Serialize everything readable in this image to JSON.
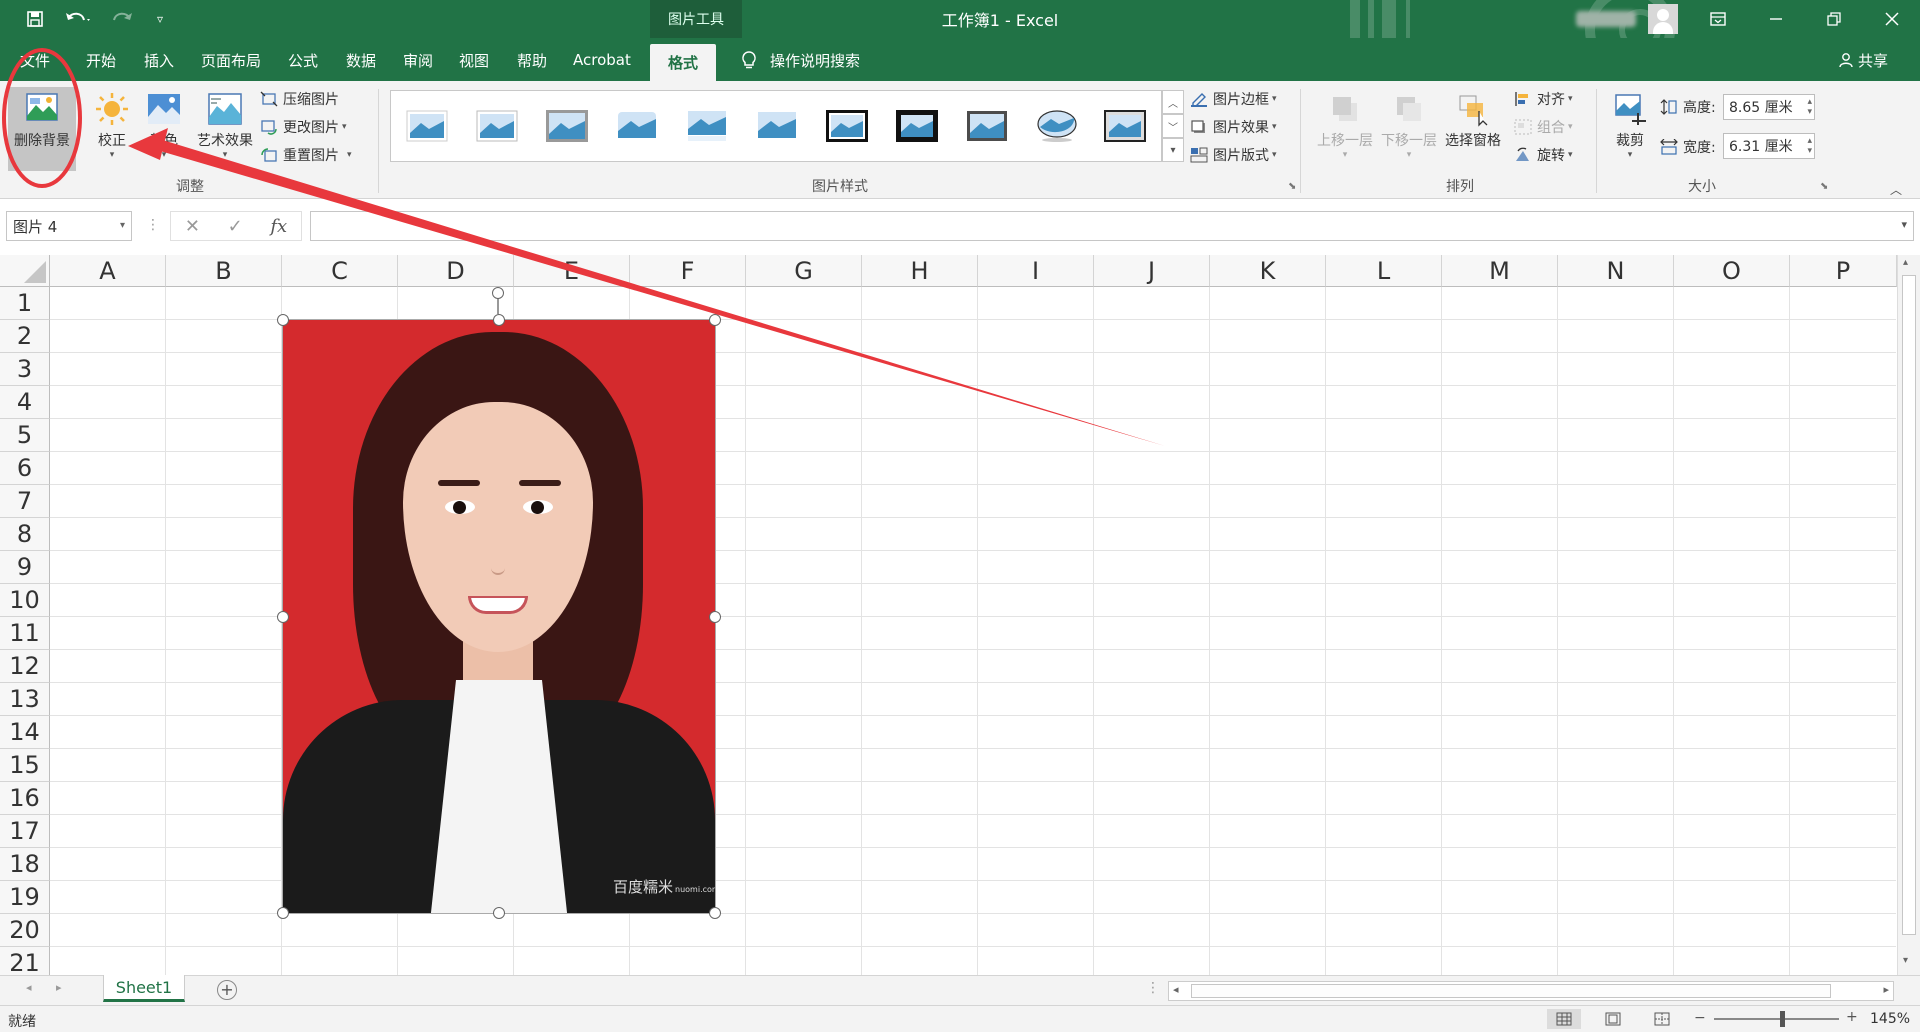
{
  "titlebar": {
    "context_tool": "图片工具",
    "document": "工作簿1 - Excel",
    "window_controls": [
      "ribbon-display-icon",
      "minimize-icon",
      "restore-icon",
      "close-icon"
    ]
  },
  "quick_access": {
    "icons": [
      "save-icon",
      "undo-icon",
      "redo-icon",
      "customize-icon"
    ]
  },
  "tabs": [
    {
      "label": "文件"
    },
    {
      "label": "开始"
    },
    {
      "label": "插入"
    },
    {
      "label": "页面布局"
    },
    {
      "label": "公式"
    },
    {
      "label": "数据"
    },
    {
      "label": "审阅"
    },
    {
      "label": "视图"
    },
    {
      "label": "帮助"
    },
    {
      "label": "Acrobat"
    },
    {
      "label": "格式"
    }
  ],
  "tell_me": "操作说明搜索",
  "share": "共享",
  "ribbon": {
    "adjust": {
      "remove_bg": "删除背景",
      "corrections": "校正",
      "color": "颜色",
      "artistic": "艺术效果",
      "compress": "压缩图片",
      "change": "更改图片",
      "reset": "重置图片",
      "label": "调整"
    },
    "styles": {
      "label": "图片样式",
      "border": "图片边框",
      "effects": "图片效果",
      "layout": "图片版式"
    },
    "arrange": {
      "label": "排列",
      "bring_forward": "上移一层",
      "send_backward": "下移一层",
      "selection_pane": "选择窗格",
      "align": "对齐",
      "group": "组合",
      "rotate": "旋转"
    },
    "size": {
      "label": "大小",
      "crop": "裁剪",
      "height_label": "高度:",
      "height_value": "8.65 厘米",
      "width_label": "宽度:",
      "width_value": "6.31 厘米"
    }
  },
  "formula_bar": {
    "name_box": "图片 4",
    "fx": "fx",
    "cancel": "✕",
    "enter": "✓",
    "value": ""
  },
  "grid": {
    "columns": [
      "A",
      "B",
      "C",
      "D",
      "E",
      "F",
      "G",
      "H",
      "I",
      "J",
      "K",
      "L",
      "M",
      "N",
      "O",
      "P"
    ],
    "rows": [
      "1",
      "2",
      "3",
      "4",
      "5",
      "6",
      "7",
      "8",
      "9",
      "10",
      "11",
      "12",
      "13",
      "14",
      "15",
      "16",
      "17",
      "18",
      "19",
      "20",
      "21"
    ]
  },
  "photo": {
    "watermark": "百度糯米",
    "watermark_small": "nuomi.com"
  },
  "sheets": [
    {
      "label": "Sheet1"
    }
  ],
  "status": {
    "text": "就绪",
    "zoom": "145%"
  },
  "colors": {
    "accent": "#217346",
    "annotation": "#e8383d"
  }
}
